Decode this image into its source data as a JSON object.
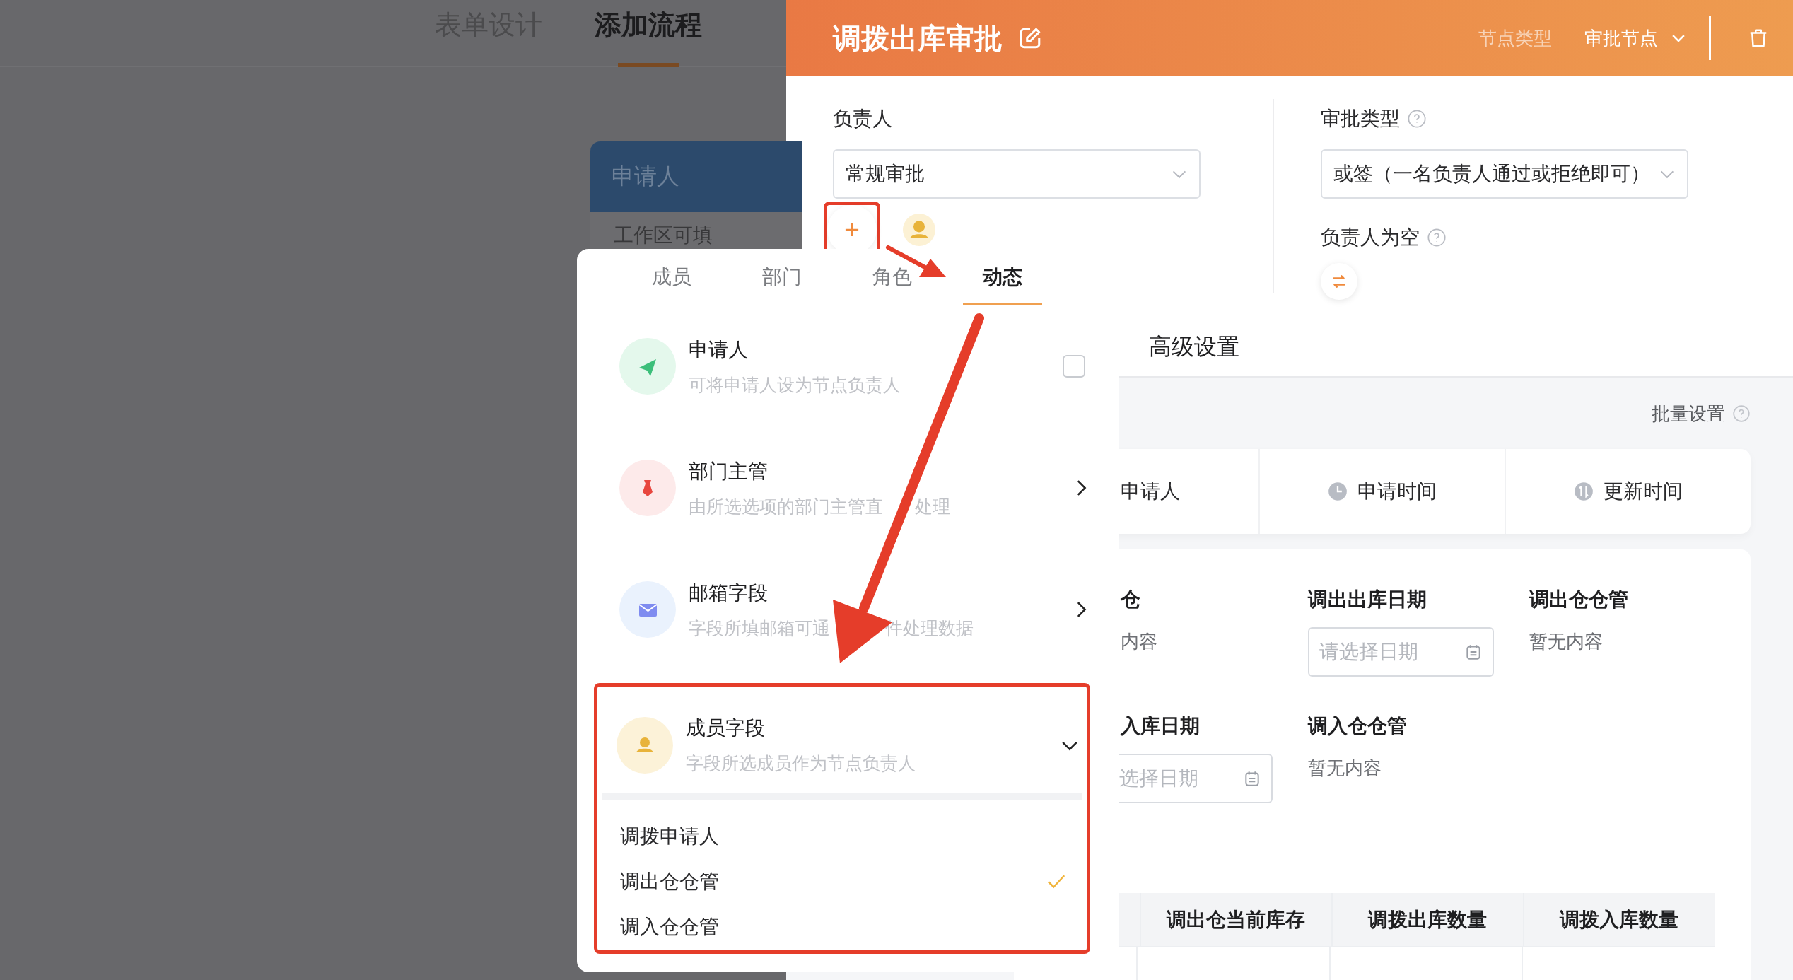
{
  "nav_tabs": [
    {
      "label": "表单设计",
      "selected": false
    },
    {
      "label": "添加流程",
      "selected": true
    }
  ],
  "flow_card": {
    "title": "申请人",
    "subtitle": "工作区可填"
  },
  "panel": {
    "title": "调拨出库审批",
    "node_type_label": "节点类型",
    "node_type": "审批节点"
  },
  "assignee": {
    "label": "负责人",
    "value": "常规审批"
  },
  "approval_type": {
    "label": "审批类型",
    "value": "或签（一名负责人通过或拒绝即可）"
  },
  "empty_assignee": {
    "label": "负责人为空"
  },
  "section_tab": "高级设置",
  "batch_settings": "批量设置",
  "system_fields": [
    {
      "label": "申请人"
    },
    {
      "label": "申请时间"
    },
    {
      "label": "更新时间"
    }
  ],
  "form_fields": [
    {
      "kind": "text",
      "label": "仓",
      "value": "内容"
    },
    {
      "kind": "date",
      "label": "调出出库日期",
      "placeholder": "请选择日期"
    },
    {
      "kind": "text",
      "label": "调出仓仓管",
      "value": "暂无内容"
    },
    {
      "kind": "date",
      "label": "入库日期",
      "placeholder": "选择日期"
    },
    {
      "kind": "text",
      "label": "调入仓仓管",
      "value": "暂无内容"
    }
  ],
  "table": {
    "columns": [
      "调出仓当前库存",
      "调拨出库数量",
      "调拨入库数量"
    ]
  },
  "popup": {
    "tabs": [
      {
        "label": "成员",
        "selected": false
      },
      {
        "label": "部门",
        "selected": false
      },
      {
        "label": "角色",
        "selected": false
      },
      {
        "label": "动态",
        "selected": true
      }
    ],
    "items": [
      {
        "kind": "checkbox",
        "title": "申请人",
        "desc": "可将申请人设为节点负责人",
        "checked": false
      },
      {
        "kind": "submenu",
        "title": "部门主管",
        "desc": [
          "由所选选项的部门主管直",
          "处理"
        ]
      },
      {
        "kind": "submenu",
        "title": "邮箱字段",
        "desc": [
          "字段所填邮箱可通",
          "件处理数据"
        ]
      },
      {
        "kind": "expand",
        "title": "成员字段",
        "desc": "字段所选成员作为节点负责人",
        "expanded": true,
        "options": [
          {
            "label": "调拨申请人",
            "selected": false
          },
          {
            "label": "调出仓仓管",
            "selected": true
          },
          {
            "label": "调入仓仓管",
            "selected": false
          }
        ]
      }
    ]
  }
}
